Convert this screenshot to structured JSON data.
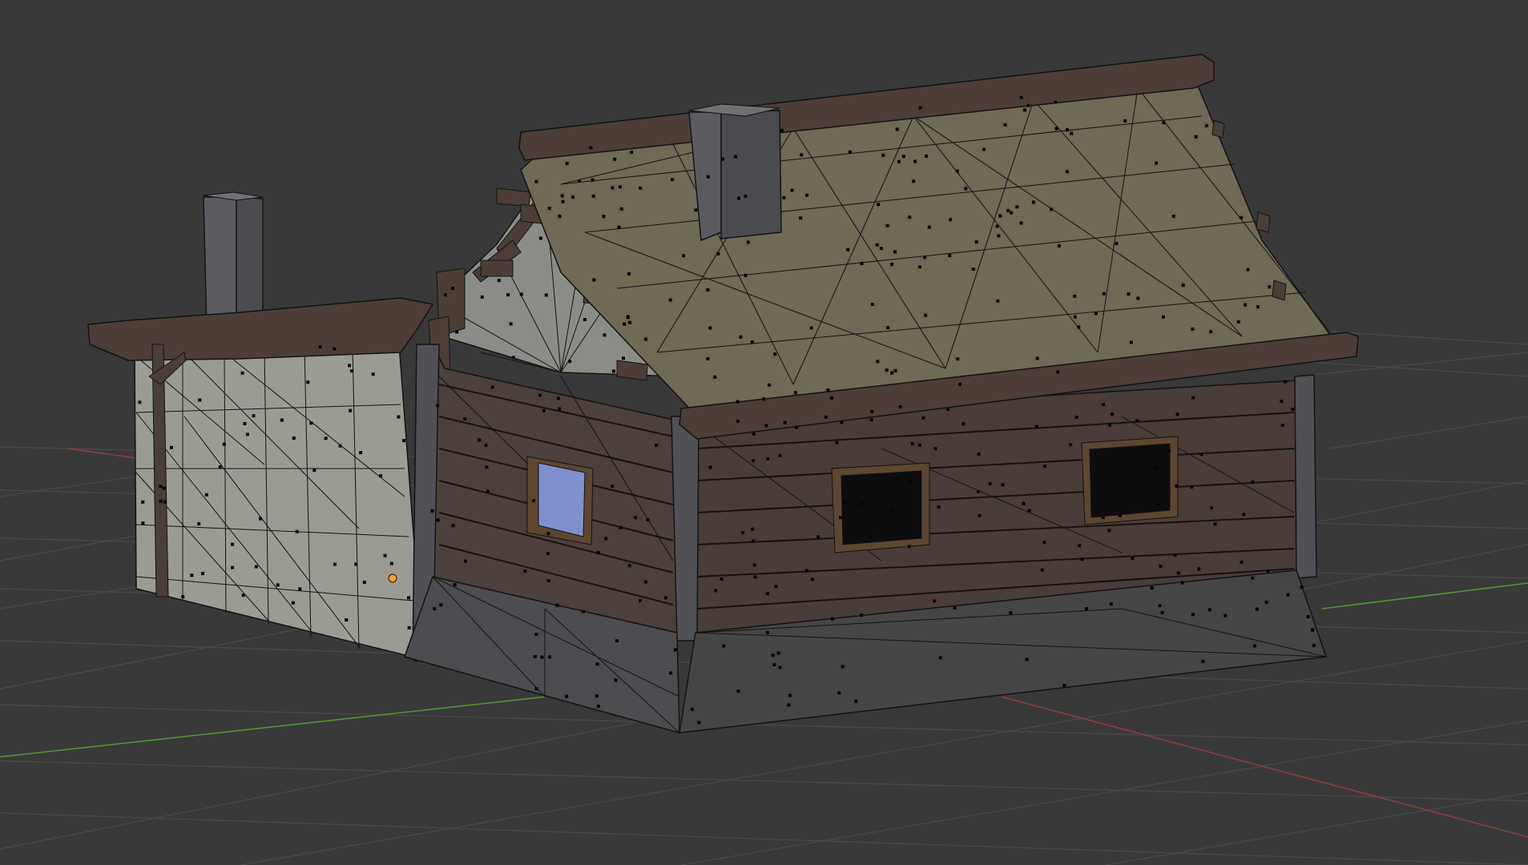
{
  "viewport": {
    "type": "3d-viewport",
    "mode": "edit-mode",
    "shading": "solid",
    "overlay": "wireframe-with-face-dots",
    "background_color": "#393939",
    "grid_color": "#4a4a4a",
    "x_axis_color": "#9a3a3a",
    "y_axis_color": "#4f9a2c",
    "selected_vertex_color": "#f0a030"
  },
  "model": {
    "object": "house",
    "parts": [
      "roof",
      "chimney",
      "side-chimney",
      "side-wing",
      "gable-wall",
      "log-wall-left",
      "log-wall-front",
      "stone-foundation",
      "window-lit",
      "window-dark",
      "roof-beams"
    ],
    "colors": {
      "roof": "#6f6955",
      "roof_beam": "#4d3d37",
      "wall_plaster": "#9b9b94",
      "gable": "#8c8c86",
      "log_wall": "#4d3f3a",
      "foundation": "#454548",
      "chimney": "#5b5c61",
      "window_glass": "#7f8fcf",
      "window_dark": "#0d0d0f",
      "window_frame": "#5d4630",
      "edge": "#141414"
    }
  }
}
